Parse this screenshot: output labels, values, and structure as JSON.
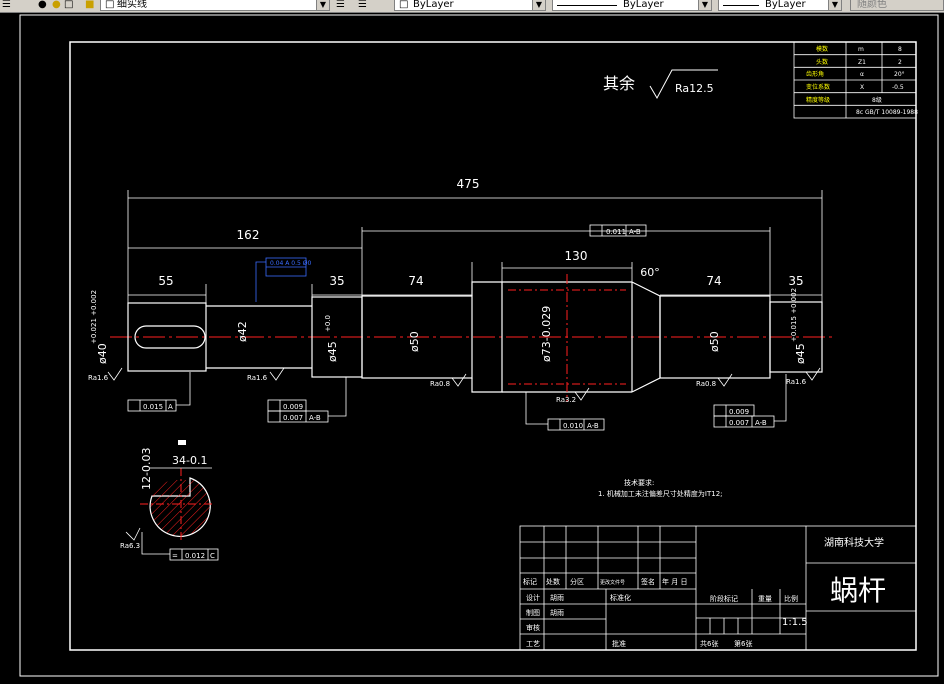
{
  "toolbar": {
    "linetype_label": "细实线",
    "color_combo": "ByLayer",
    "linetype_combo": "ByLayer",
    "lineweight_combo": "ByLayer",
    "plotstyle_combo": "随颜色"
  },
  "drawing": {
    "surface_note": {
      "prefix": "其余",
      "value": "Ra12.5"
    },
    "dims": {
      "d475": "475",
      "d162": "162",
      "d55": "55",
      "d35a": "35",
      "d74a": "74",
      "d130": "130",
      "d60": "60°",
      "d74b": "74",
      "d35b": "35",
      "phi42": "ø42",
      "phi50a": "ø50",
      "phi73": "ø73-0.029",
      "phi50b": "ø50",
      "phi40": "ø40",
      "phi40_tol": "+0.021\n+0.002",
      "phi45a": "ø45",
      "phi45a_tol": "+0.0",
      "phi45b": "ø45",
      "phi45b_tol": "+0.015\n+0.002",
      "key_depth": "34-0.1",
      "key_width": "12-0.03"
    },
    "roughness": [
      "Ra1.6",
      "Ra1.6",
      "Ra0.8",
      "Ra3.2",
      "Ra0.8",
      "Ra1.6"
    ],
    "tolerances": {
      "top_runout": "0.011",
      "top_runout_ref": "A-B",
      "left_runout": "0.015",
      "left_runout_ref": "A",
      "mid_a": "0.009",
      "mid_b": "0.007",
      "mid_ref": "A-B",
      "center": "0.010",
      "center_ref": "A-B",
      "right_a": "0.009",
      "right_b": "0.007",
      "right_ref": "A-B",
      "section_sym": "0.012",
      "section_ref": "C"
    },
    "blue_annotation": "0.04 A\n0.5 Ø0",
    "datum_label": "Ra6.3"
  },
  "tech_requirements": {
    "title": "技术要求:",
    "line1": "1. 机械加工未注偏差尺寸处精度为IT12;"
  },
  "param_table": [
    [
      "模数",
      "m",
      "8"
    ],
    [
      "头数",
      "Z1",
      "2"
    ],
    [
      "齿形角",
      "α",
      "20°"
    ],
    [
      "变位系数",
      "X",
      "-0.5"
    ],
    [
      "精度等级",
      "",
      "8级"
    ],
    [
      "",
      "",
      "8c GB/T 10089-1988"
    ]
  ],
  "title_block": {
    "school": "湖南科技大学",
    "part_name": "蜗杆",
    "scale_label": "比例",
    "scale_value": "1:1.5",
    "weight_label": "重量",
    "stage_label": "阶段标记",
    "sheets_total": "共6张",
    "sheet_no": "第6张",
    "rev_headers": [
      "标记",
      "处数",
      "分区",
      "更改文件号",
      "签名",
      "年 月 日"
    ],
    "design_label": "设计",
    "design_name": "胡雨",
    "draw_label": "制图",
    "draw_name": "胡雨",
    "std_label": "标准化",
    "check_label": "审核",
    "process_label": "工艺",
    "approve_label": "批准"
  },
  "colors": {
    "white": "#ffffff",
    "red": "#ff2020",
    "blue": "#3a6cff",
    "yellow": "#ffff00"
  }
}
